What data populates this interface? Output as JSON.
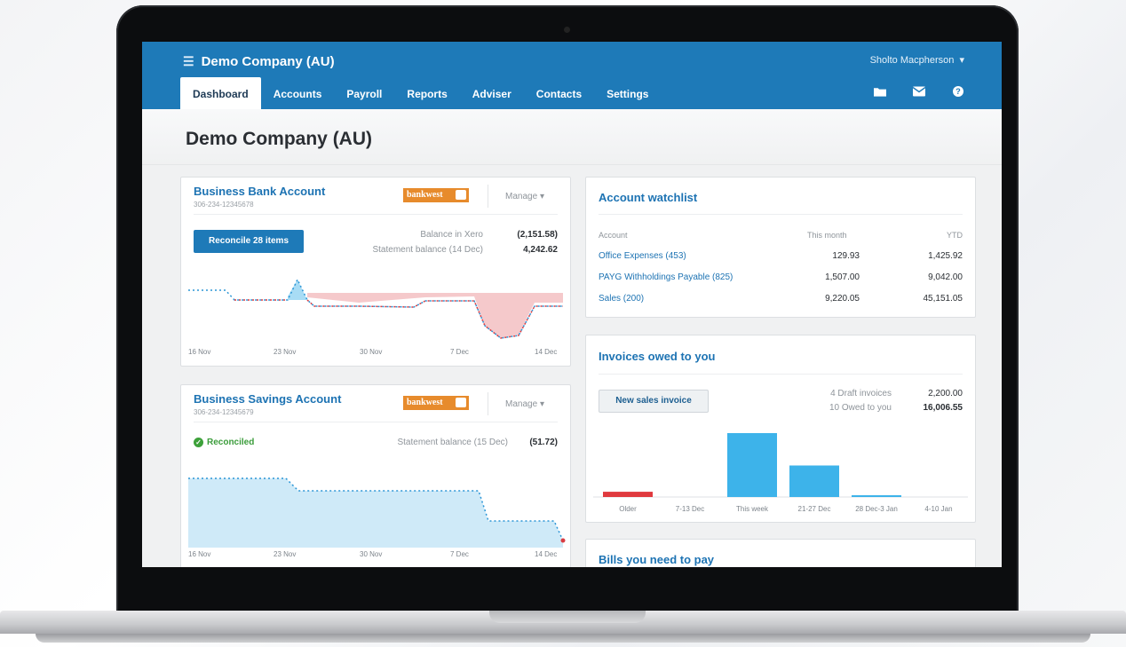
{
  "header": {
    "org_name": "Demo Company (AU)",
    "user_name": "Sholto Macpherson",
    "tabs": [
      "Dashboard",
      "Accounts",
      "Payroll",
      "Reports",
      "Adviser",
      "Contacts",
      "Settings"
    ],
    "icons": [
      "folder-icon",
      "mail-icon",
      "help-icon"
    ]
  },
  "page": {
    "title": "Demo Company (AU)"
  },
  "bank_account": {
    "name": "Business Bank Account",
    "number": "306-234-12345678",
    "bank": "bankwest",
    "manage": "Manage",
    "reconcile_button": "Reconcile 28 items",
    "balance_xero_label": "Balance in Xero",
    "balance_xero_value": "(2,151.58)",
    "statement_label": "Statement balance (14 Dec)",
    "statement_value": "4,242.62",
    "x_labels": [
      "16 Nov",
      "23 Nov",
      "30 Nov",
      "7 Dec",
      "14 Dec"
    ]
  },
  "savings_account": {
    "name": "Business Savings Account",
    "number": "306-234-12345679",
    "bank": "bankwest",
    "manage": "Manage",
    "status": "Reconciled",
    "statement_label": "Statement balance (15 Dec)",
    "statement_value": "(51.72)",
    "x_labels": [
      "16 Nov",
      "23 Nov",
      "30 Nov",
      "7 Dec",
      "14 Dec"
    ]
  },
  "watchlist": {
    "title": "Account watchlist",
    "headers": [
      "Account",
      "This month",
      "YTD"
    ],
    "rows": [
      {
        "account": "Office Expenses (453)",
        "month": "129.93",
        "ytd": "1,425.92"
      },
      {
        "account": "PAYG Withholdings Payable (825)",
        "month": "1,507.00",
        "ytd": "9,042.00"
      },
      {
        "account": "Sales (200)",
        "month": "9,220.05",
        "ytd": "45,151.05"
      }
    ]
  },
  "invoices": {
    "title": "Invoices owed to you",
    "new_button": "New sales invoice",
    "draft_label": "4 Draft invoices",
    "draft_value": "2,200.00",
    "owed_label": "10 Owed to you",
    "owed_value": "16,006.55"
  },
  "bills": {
    "title": "Bills you need to pay"
  },
  "chart_data": {
    "type": "bar",
    "categories": [
      "Older",
      "7-13 Dec",
      "This week",
      "21-27 Dec",
      "28 Dec-3 Jan",
      "4-10 Jan"
    ],
    "values": [
      300,
      0,
      3650,
      1800,
      60,
      0
    ],
    "colors": [
      "#e0393e",
      "#3db3ea",
      "#3db3ea",
      "#3db3ea",
      "#3db3ea",
      "#3db3ea"
    ]
  },
  "colors": {
    "brand": "#1e7ab8",
    "link": "#1d73b3",
    "bar": "#3db3ea",
    "overdue": "#e0393e"
  }
}
